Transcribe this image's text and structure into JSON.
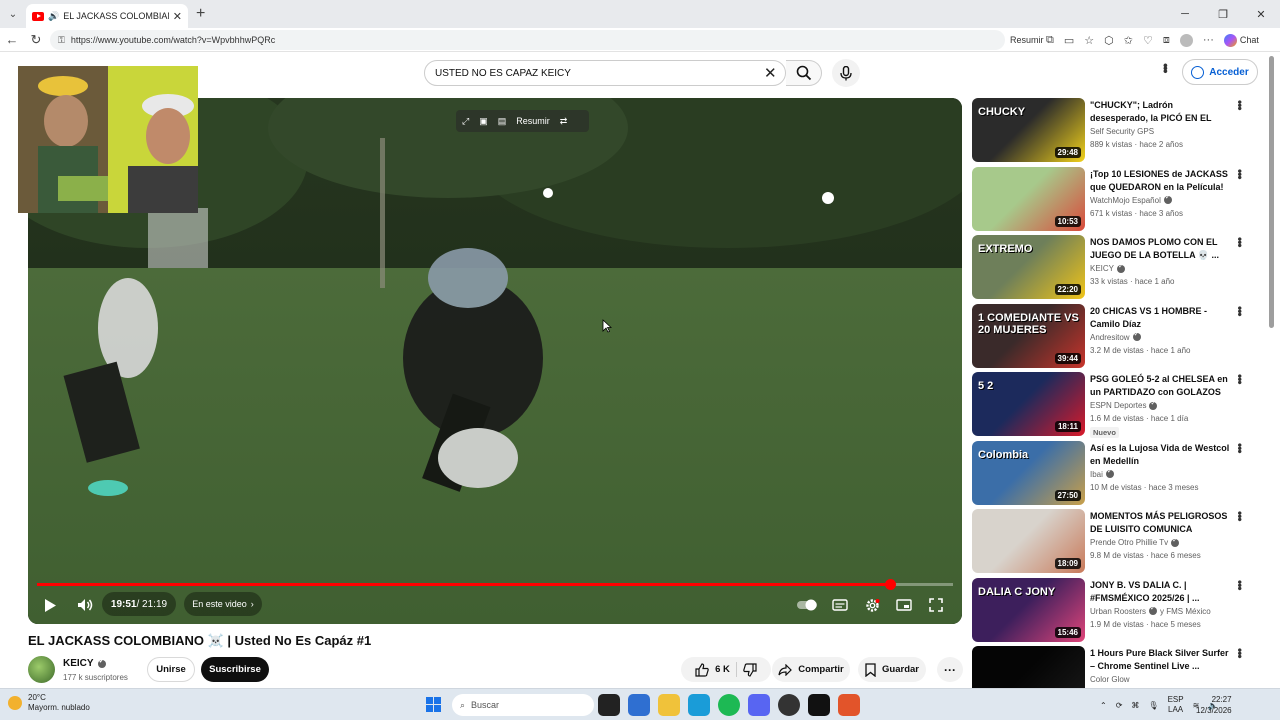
{
  "browser": {
    "tab_title": "EL JACKASS COLOMBIANO 🏃",
    "url": "https://www.youtube.com/watch?v=WpvbhhwPQRc",
    "summarize_label": "Resumir",
    "chat_label": "Chat"
  },
  "header": {
    "search_value": "USTED NO ES CAPAZ KEICY",
    "signin_label": "Acceder"
  },
  "player": {
    "overlay_summarize": "Resumir",
    "time_current": "19:51",
    "time_total": " / 21:19",
    "chapter_label": "En este video",
    "progress": 0.931
  },
  "video": {
    "title": "EL JACKASS COLOMBIANO ☠️ | Usted No Es Capáz #1",
    "channel": "KEICY",
    "subscribers": "177 k suscriptores",
    "join_label": "Unirse",
    "subscribe_label": "Suscribirse",
    "likes": "6 K",
    "share_label": "Compartir",
    "save_label": "Guardar"
  },
  "related": [
    {
      "title": "\"CHUCKY\"; Ladrón desesperado, la PICÓ EN EL BAÑO",
      "channel": "Self Security GPS",
      "verified": false,
      "meta": "889 k vistas · hace 2 años",
      "duration": "29:48",
      "thumb_text": "CHUCKY",
      "color_a": "#2b2b2b",
      "color_b": "#f2d21b"
    },
    {
      "title": "¡Top 10 LESIONES de JACKASS que QUEDARON en la Película!",
      "channel": "WatchMojo Español",
      "verified": true,
      "meta": "671 k vistas · hace 3 años",
      "duration": "10:53",
      "thumb_text": "",
      "color_a": "#a7c98b",
      "color_b": "#d94a3b"
    },
    {
      "title": "NOS DAMOS PLOMO CON EL JUEGO DE LA BOTELLA 💀 ...",
      "channel": "KEICY",
      "verified": true,
      "meta": "33 k vistas · hace 1 año",
      "duration": "22:20",
      "thumb_text": "EXTREMO",
      "color_a": "#6e7f5a",
      "color_b": "#f0c419"
    },
    {
      "title": "20 CHICAS VS 1 HOMBRE - Camilo Díaz",
      "channel": "Andresitow",
      "verified": true,
      "meta": "3.2 M de vistas · hace 1 año",
      "duration": "39:44",
      "thumb_text": "1 COMEDIANTE VS 20 MUJERES",
      "color_a": "#3a2a2a",
      "color_b": "#c8342b"
    },
    {
      "title": "PSG GOLEÓ 5-2 al CHELSEA en un PARTIDAZO con GOLAZOS ...",
      "channel": "ESPN Deportes",
      "verified": true,
      "meta": "1.6 M de vistas · hace 1 día",
      "badge": "Nuevo",
      "duration": "18:11",
      "thumb_text": "5 2",
      "color_a": "#1c2a5c",
      "color_b": "#d91a2a"
    },
    {
      "title": "Así es la Lujosa Vida de Westcol en Medellín",
      "channel": "Ibai",
      "verified": true,
      "meta": "10 M de vistas · hace 3 meses",
      "duration": "27:50",
      "thumb_text": "Colombia",
      "color_a": "#3b6ea8",
      "color_b": "#c9a04a"
    },
    {
      "title": "MOMENTOS MÁS PELIGROSOS DE LUISITO COMUNICA",
      "channel": "Prende Otro Phillie Tv",
      "verified": true,
      "meta": "9.8 M de vistas · hace 6 meses",
      "duration": "18:09",
      "thumb_text": "",
      "color_a": "#d8d3cc",
      "color_b": "#c97a5a"
    },
    {
      "title": "JONY B. VS DALIA C. | #FMSMÉXICO 2025/26 | ...",
      "channel": "Urban Roosters",
      "channel2": "y FMS México",
      "verified": true,
      "meta": "1.9 M de vistas · hace 5 meses",
      "duration": "15:46",
      "thumb_text": "DALIA C JONY",
      "color_a": "#3d1f5c",
      "color_b": "#e0457a"
    },
    {
      "title": "1 Hours Pure Black Silver Surfer – Chrome Sentinel Live ...",
      "channel": "Color Glow",
      "verified": false,
      "meta": "",
      "duration": "",
      "thumb_text": "",
      "color_a": "#050505",
      "color_b": "#1a1a1a"
    }
  ],
  "taskbar": {
    "temperature": "20°C",
    "weather": "Mayorm. nublado",
    "search_label": "Buscar",
    "lang_1": "ESP",
    "lang_2": "LAA",
    "time": "22:27",
    "date": "12/3/2026"
  },
  "colors": {
    "accent_red": "#ff0000",
    "link_blue": "#065fd4"
  }
}
